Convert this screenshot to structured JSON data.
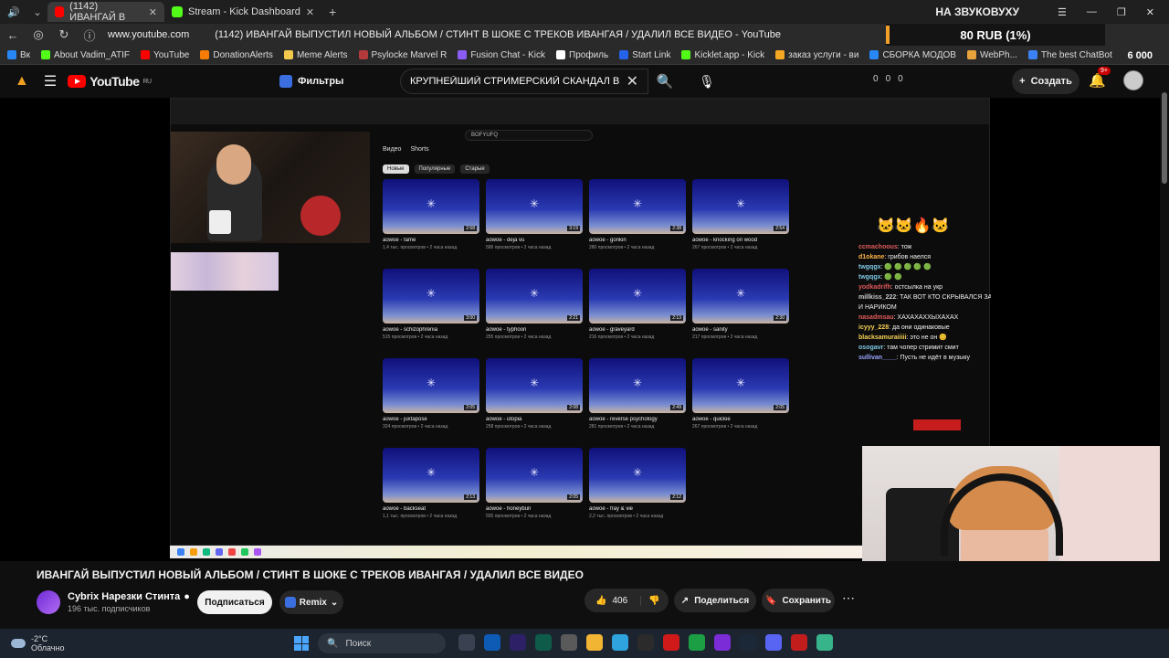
{
  "browser": {
    "tabs": [
      {
        "label": "(1142) ИВАНГАЙ В",
        "active": true
      },
      {
        "label": "Stream - Kick Dashboard",
        "active": false
      }
    ],
    "sound_title": "НА ЗВУКОВУХУ",
    "url": "www.youtube.com",
    "page_title": "(1142) ИВАНГАЙ ВЫПУСТИЛ НОВЫЙ АЛЬБОМ / СТИНТ В ШОКЕ С ТРЕКОВ ИВАНГАЯ / УДАЛИЛ ВСЕ ВИДЕО - YouTube",
    "donation_text": "80 RUB (1%)",
    "bookmarks": [
      "Вк",
      "About Vadim_ATIF",
      "YouTube",
      "DonationAlerts",
      "Meme Alerts",
      "Psylocke Marvel R",
      "Fusion Chat - Kick",
      "Профиль",
      "Start Link",
      "Kicklet.app - Kick",
      "заказ услуги - ви",
      "СБОРКА МОДОВ",
      "WebPh...",
      "The best ChatBot"
    ],
    "bookmark_count": "6 000"
  },
  "youtube": {
    "logo_text": "YouTube",
    "logo_region": "RU",
    "filters_label": "Фильтры",
    "search_value": "КРУПНЕЙШИЙ СТРИМЕРСКИЙ СКАНДАЛ В",
    "stats": [
      "0",
      "0",
      "0"
    ],
    "create_label": "Создать",
    "notif_badge": "9+"
  },
  "inner": {
    "search_value": "BOFYUFQ",
    "tabs": [
      "Видео",
      "Shorts"
    ],
    "chips": [
      "Новые",
      "Популярные",
      "Старые"
    ],
    "videos": [
      {
        "title": "aowoe - fame",
        "meta": "1,4 тыс. просмотров • 2 часа назад",
        "dur": "2:58"
      },
      {
        "title": "aowoe - deja vu",
        "meta": "586 просмотров • 2 часа назад",
        "dur": "3:19"
      },
      {
        "title": "aowoe - gonkin",
        "meta": "280 просмотров • 2 часа назад",
        "dur": "2:38"
      },
      {
        "title": "aowoe - knocking on wood",
        "meta": "267 просмотров • 2 часа назад",
        "dur": "2:54"
      },
      {
        "title": "aowoe - schizophrenia",
        "meta": "515 просмотров • 2 часа назад",
        "dur": "3:00"
      },
      {
        "title": "aowoe - typhoon",
        "meta": "255 просмотров • 2 часа назад",
        "dur": "2:21"
      },
      {
        "title": "aowoe - graveyard",
        "meta": "216 просмотров • 2 часа назад",
        "dur": "2:13"
      },
      {
        "title": "aowoe - sanity",
        "meta": "217 просмотров • 2 часа назад",
        "dur": "2:30"
      },
      {
        "title": "aowoe - juxtapose",
        "meta": "324 просмотров • 2 часа назад",
        "dur": "2:05"
      },
      {
        "title": "aowoe - utopia",
        "meta": "258 просмотров • 2 часа назад",
        "dur": "2:08"
      },
      {
        "title": "aowoe - reverse psychology",
        "meta": "281 просмотров • 2 часа назад",
        "dur": "2:49"
      },
      {
        "title": "aowoe - quickie",
        "meta": "267 просмотров • 2 часа назад",
        "dur": "2:05"
      },
      {
        "title": "aowoe - backseat",
        "meta": "1,1 тыс. просмотров • 2 часа назад",
        "dur": "2:13"
      },
      {
        "title": "aowoe - honeybun",
        "meta": "555 просмотров • 2 часа назад",
        "dur": "2:05"
      },
      {
        "title": "aowoe - fray & vie",
        "meta": "2,2 тыс. просмотров • 2 часа назад",
        "dur": "2:12"
      }
    ],
    "chat": [
      {
        "user": "ccmachoous",
        "text": ": тож"
      },
      {
        "user": "d1okane",
        "text": ": грибов наелся"
      },
      {
        "user": "twgqgx",
        "text": ": 🟢 🟢 🟢 🟢 🟢"
      },
      {
        "user": "twgqgx",
        "text": ": 🟢 🟢"
      },
      {
        "user": "yodkadrifh",
        "text": ": остсылка на укр"
      },
      {
        "user": "millkiss_222",
        "text": ": ТАК ВОТ КТО СКРЫВАЛСЯ ЗА"
      },
      {
        "user": "",
        "text": "И НАРИКОМ"
      },
      {
        "user": "nasadmsau",
        "text": ": ХАХАХАХХЫХАХАХ"
      },
      {
        "user": "icyyy_228",
        "text": ": да они одинаковые"
      },
      {
        "user": "blacksamuraiiiii",
        "text": ": это не он 😊"
      },
      {
        "user": "osogavr",
        "text": ": там чопер стримит смит"
      },
      {
        "user": "sullivan____",
        "text": ": Пусть не идёт в музыку"
      }
    ]
  },
  "video_info": {
    "title": "ИВАНГАЙ ВЫПУСТИЛ НОВЫЙ АЛЬБОМ / СТИНТ В ШОКЕ С ТРЕКОВ ИВАНГАЯ / УДАЛИЛ ВСЕ ВИДЕО",
    "channel_name": "Cybrix Нарезки Стинта",
    "subscribers": "196 тыс. подписчиков",
    "subscribe_label": "Подписаться",
    "remix_label": "Remix",
    "likes": "406",
    "share_label": "Поделиться",
    "save_label": "Сохранить"
  },
  "taskbar": {
    "temp": "-2°C",
    "weather": "Облачно",
    "search_label": "Поиск"
  },
  "colors": {
    "accent_red": "#ff0000",
    "kick_green": "#53fc18",
    "thumb_blue": "#2a3ab2"
  }
}
